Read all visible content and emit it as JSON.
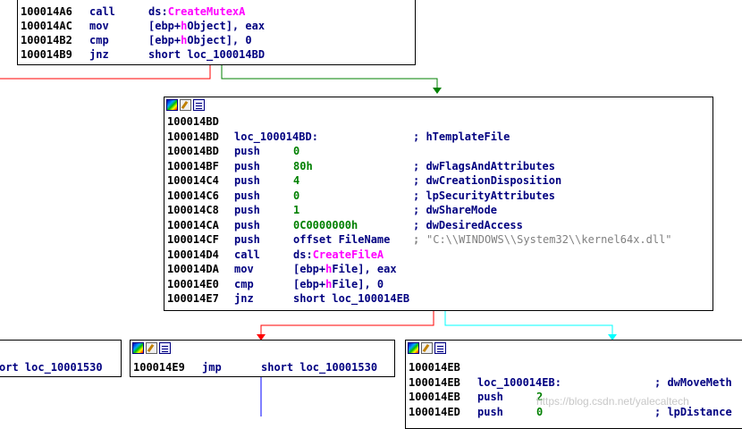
{
  "block_top": {
    "lines": [
      {
        "addr": "100014A6",
        "mnem": "call",
        "operand_prefix": "ds:",
        "operand_import": "CreateMutexA"
      },
      {
        "addr": "100014AC",
        "mnem": "mov",
        "operand": "[ebp+hObject], eax",
        "operand_hl": "h"
      },
      {
        "addr": "100014B2",
        "mnem": "cmp",
        "operand": "[ebp+hObject], 0",
        "operand_hl": "h"
      },
      {
        "addr": "100014B9",
        "mnem": "jnz",
        "operand": "short loc_100014BD"
      }
    ]
  },
  "block_mid": {
    "lines": [
      {
        "addr": "100014BD",
        "label": "",
        "mnem": "",
        "operand": "",
        "comment": ""
      },
      {
        "addr": "100014BD",
        "label": "loc_100014BD:",
        "mnem": "",
        "operand": "",
        "comment": "; hTemplateFile"
      },
      {
        "addr": "100014BD",
        "mnem": "push",
        "operand": "0",
        "comment": ""
      },
      {
        "addr": "100014BF",
        "mnem": "push",
        "operand": "80h",
        "comment": "; dwFlagsAndAttributes"
      },
      {
        "addr": "100014C4",
        "mnem": "push",
        "operand": "4",
        "comment": "; dwCreationDisposition"
      },
      {
        "addr": "100014C6",
        "mnem": "push",
        "operand": "0",
        "comment": "; lpSecurityAttributes"
      },
      {
        "addr": "100014C8",
        "mnem": "push",
        "operand": "1",
        "comment": "; dwShareMode"
      },
      {
        "addr": "100014CA",
        "mnem": "push",
        "operand": "0C0000000h",
        "comment": "; dwDesiredAccess"
      },
      {
        "addr": "100014CF",
        "mnem": "push",
        "operand": "offset FileName",
        "comment": ";",
        "string": "\"C:\\\\WINDOWS\\\\System32\\\\kernel64x.dll\""
      },
      {
        "addr": "100014D4",
        "mnem": "call",
        "operand_prefix": "ds:",
        "operand_import": "CreateFileA"
      },
      {
        "addr": "100014DA",
        "mnem": "mov",
        "operand": "[ebp+hFile], eax"
      },
      {
        "addr": "100014E0",
        "mnem": "cmp",
        "operand": "[ebp+hFile], 0"
      },
      {
        "addr": "100014E7",
        "mnem": "jnz",
        "operand": "short loc_100014EB"
      }
    ]
  },
  "block_left": {
    "line": "ort loc_10001530"
  },
  "block_jmp": {
    "addr": "100014E9",
    "mnem": "jmp",
    "operand": "short loc_10001530"
  },
  "block_right": {
    "lines": [
      {
        "addr": "100014EB",
        "label": "",
        "mnem": "",
        "operand": "",
        "comment": ""
      },
      {
        "addr": "100014EB",
        "label": "loc_100014EB:",
        "comment": "; dwMoveMeth"
      },
      {
        "addr": "100014EB",
        "mnem": "push",
        "operand": "2"
      },
      {
        "addr": "100014ED",
        "mnem": "push",
        "operand": "0",
        "comment": "; lpDistance"
      }
    ]
  },
  "watermark": "https://blog.csdn.net/yalecaltech",
  "colors": {
    "edge_red": "#ff0000",
    "edge_green": "#008000",
    "edge_cyan": "#00ffff",
    "edge_blue": "#0000ff"
  }
}
